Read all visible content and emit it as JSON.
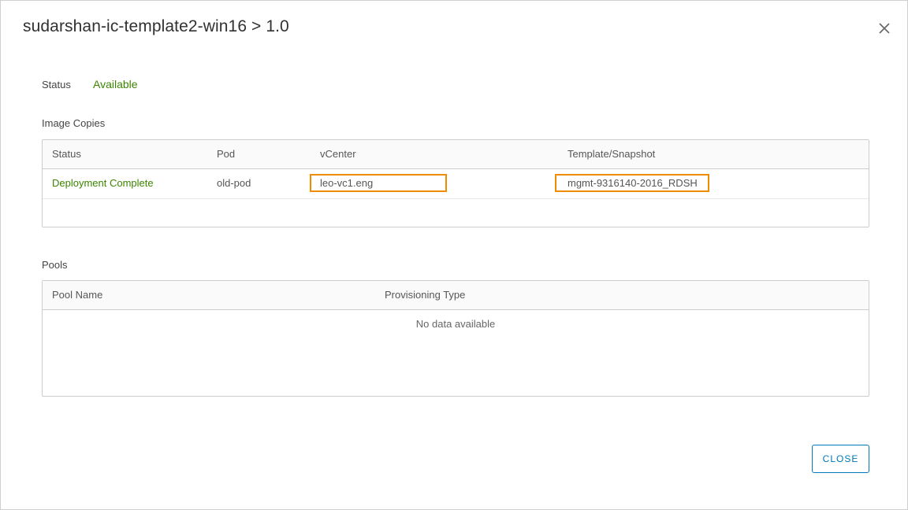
{
  "dialog": {
    "title": "sudarshan-ic-template2-win16 > 1.0",
    "close_icon": "close-icon"
  },
  "status": {
    "label": "Status",
    "value": "Available",
    "value_color": "#3c8500"
  },
  "image_copies": {
    "label": "Image Copies",
    "columns": [
      "Status",
      "Pod",
      "vCenter",
      "Template/Snapshot"
    ],
    "rows": [
      {
        "status": "Deployment Complete",
        "pod": "old-pod",
        "vcenter": "leo-vc1.eng",
        "template": "mgmt-9316140-2016_RDSH"
      }
    ],
    "highlight_color": "#f08c00"
  },
  "pools": {
    "label": "Pools",
    "columns": [
      "Pool Name",
      "Provisioning Type"
    ],
    "empty_text": "No data available"
  },
  "footer": {
    "close_label": "CLOSE",
    "accent": "#0079b8"
  }
}
